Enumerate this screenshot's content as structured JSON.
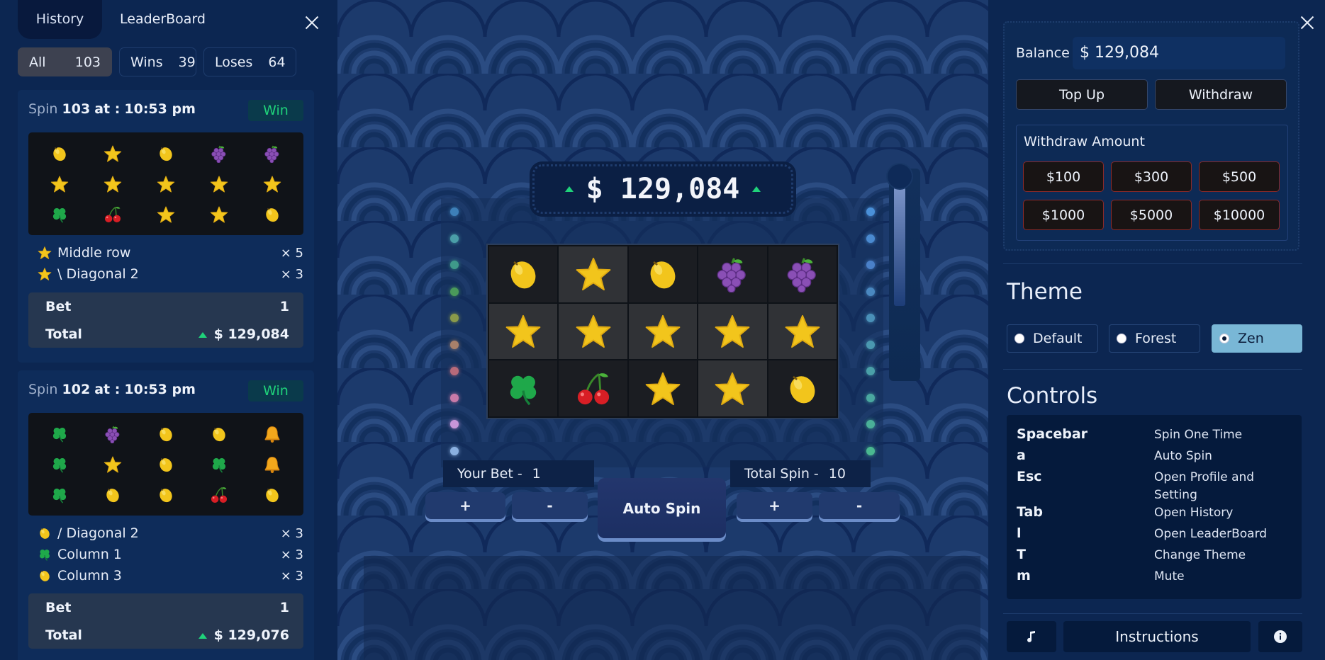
{
  "history_panel": {
    "tabs": [
      {
        "label": "History",
        "active": true
      },
      {
        "label": "LeaderBoard",
        "active": false
      }
    ],
    "filters": [
      {
        "label": "All",
        "count": "103",
        "active": true
      },
      {
        "label": "Wins",
        "count": "39",
        "active": false
      },
      {
        "label": "Loses",
        "count": "64",
        "active": false
      }
    ],
    "spins": [
      {
        "prefix": "Spin",
        "number": "103",
        "at": "at :",
        "time": "10:53 pm",
        "result": "Win",
        "grid": [
          [
            "lemon",
            "star",
            "lemon",
            "grapes",
            "grapes"
          ],
          [
            "star",
            "star",
            "star",
            "star",
            "star"
          ],
          [
            "clover",
            "cherry",
            "star",
            "star",
            "lemon"
          ]
        ],
        "lines": [
          {
            "icon": "star",
            "label": "Middle row",
            "mult": "× 5"
          },
          {
            "icon": "star",
            "label": "\\ Diagonal 2",
            "mult": "× 3"
          }
        ],
        "bet_label": "Bet",
        "bet": "1",
        "total_label": "Total",
        "total": "$ 129,084"
      },
      {
        "prefix": "Spin",
        "number": "102",
        "at": "at :",
        "time": "10:53 pm",
        "result": "Win",
        "grid": [
          [
            "clover",
            "grapes",
            "lemon",
            "lemon",
            "bell"
          ],
          [
            "clover",
            "star",
            "lemon",
            "clover",
            "bell"
          ],
          [
            "clover",
            "lemon",
            "lemon",
            "cherry",
            "lemon"
          ]
        ],
        "lines": [
          {
            "icon": "lemon",
            "label": "/ Diagonal 2",
            "mult": "× 3"
          },
          {
            "icon": "clover",
            "label": "Column 1",
            "mult": "× 3"
          },
          {
            "icon": "lemon",
            "label": "Column 3",
            "mult": "× 3"
          }
        ],
        "bet_label": "Bet",
        "bet": "1",
        "total_label": "Total",
        "total": "$ 129,076"
      }
    ]
  },
  "machine": {
    "display_amount": "$ 129,084",
    "reels": [
      [
        "lemon",
        "star",
        "lemon",
        "grapes",
        "grapes"
      ],
      [
        "star",
        "star",
        "star",
        "star",
        "star"
      ],
      [
        "clover",
        "cherry",
        "star",
        "star",
        "lemon"
      ]
    ],
    "your_bet_label": "Your Bet -",
    "your_bet_value": "1",
    "total_spin_label": "Total Spin -",
    "total_spin_value": "10",
    "bet_plus": "+",
    "bet_minus": "-",
    "spin_plus": "+",
    "spin_minus": "-",
    "auto_spin_label": "Auto Spin"
  },
  "settings_panel": {
    "balance_label": "Balance",
    "balance_value": "$ 129,084",
    "top_up_label": "Top Up",
    "withdraw_label": "Withdraw",
    "withdraw_amount_title": "Withdraw Amount",
    "amounts": [
      "$100",
      "$300",
      "$500",
      "$1000",
      "$5000",
      "$10000"
    ],
    "theme_title": "Theme",
    "themes": [
      {
        "label": "Default",
        "selected": false
      },
      {
        "label": "Forest",
        "selected": false
      },
      {
        "label": "Zen",
        "selected": true
      }
    ],
    "controls_title": "Controls",
    "controls": [
      {
        "key": "Spacebar",
        "action": "Spin One Time"
      },
      {
        "key": "a",
        "action": "Auto Spin"
      },
      {
        "key": "Esc",
        "action": "Open Profile and Setting"
      },
      {
        "key": "Tab",
        "action": "Open History"
      },
      {
        "key": "l",
        "action": "Open LeaderBoard"
      },
      {
        "key": "T",
        "action": "Change Theme"
      },
      {
        "key": "m",
        "action": "Mute"
      }
    ],
    "music_icon": "music-note-icon",
    "instructions_label": "Instructions",
    "info_icon": "info-icon"
  },
  "colors": {
    "win_green": "#1fd27a",
    "panel_bg": "#0c2651",
    "theme_selected": "#79b7d6",
    "amount_border": "#8a2a2a"
  }
}
